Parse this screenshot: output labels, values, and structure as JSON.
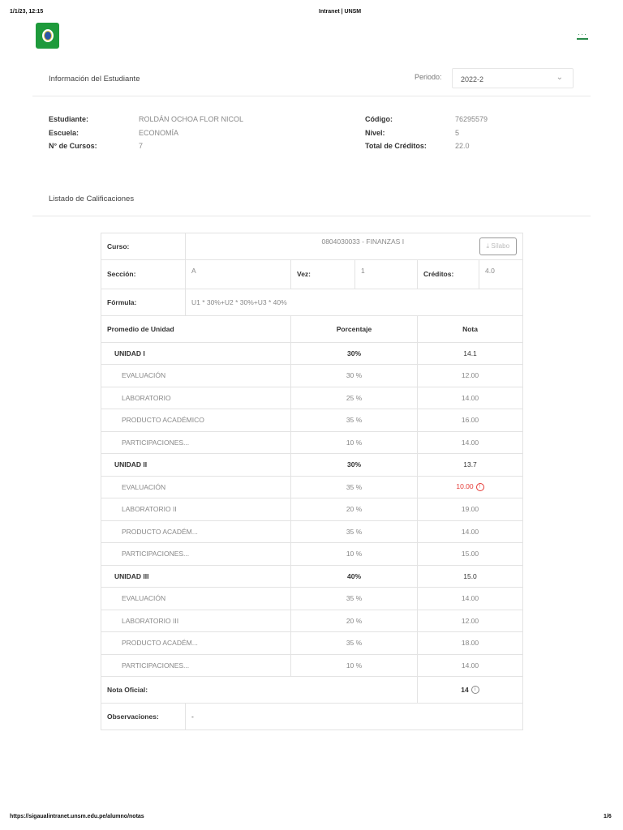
{
  "print_header": {
    "datetime": "1/1/23, 12:15",
    "page_title": "Intranet | UNSM"
  },
  "print_footer": {
    "url": "https://sigaualintranet.unsm.edu.pe/alumno/notas",
    "page": "1/6"
  },
  "student_section": {
    "title": "Información del Estudiante",
    "periodo_label": "Periodo:",
    "periodo_value": "2022-2"
  },
  "student": {
    "estudiante_label": "Estudiante:",
    "estudiante": "ROLDÁN OCHOA FLOR NICOL",
    "escuela_label": "Escuela:",
    "escuela": "ECONOMÍA",
    "cursos_label": "N° de Cursos:",
    "cursos": "7",
    "codigo_label": "Código:",
    "codigo": "76295579",
    "nivel_label": "Nivel:",
    "nivel": "5",
    "creditos_label": "Total de Créditos:",
    "creditos": "22.0"
  },
  "grades_section": {
    "title": "Listado de Calificaciones"
  },
  "course": {
    "curso_label": "Curso:",
    "curso": "0804030033 - FINANZAS I",
    "silabo_label": "Sílabo",
    "seccion_label": "Sección:",
    "seccion": "A",
    "vez_label": "Vez:",
    "vez": "1",
    "creditos_label": "Créditos:",
    "creditos": "4.0",
    "formula_label": "Fórmula:",
    "formula": "U1 * 30%+U2 * 30%+U3 * 40%",
    "headers": [
      "Promedio de Unidad",
      "Porcentaje",
      "Nota"
    ],
    "rows": [
      {
        "unit": true,
        "name": "UNIDAD I",
        "pct": "30%",
        "nota": "14.1"
      },
      {
        "name": "EVALUACIÓN",
        "pct": "30 %",
        "nota": "12.00"
      },
      {
        "name": "LABORATORIO",
        "pct": "25 %",
        "nota": "14.00"
      },
      {
        "name": "PRODUCTO ACADÉMICO",
        "pct": "35 %",
        "nota": "16.00"
      },
      {
        "name": "PARTICIPACIONES...",
        "pct": "10 %",
        "nota": "14.00"
      },
      {
        "unit": true,
        "name": "UNIDAD II",
        "pct": "30%",
        "nota": "13.7"
      },
      {
        "name": "EVALUACIÓN",
        "pct": "35 %",
        "nota": "10.00",
        "alert": true
      },
      {
        "name": "LABORATORIO II",
        "pct": "20 %",
        "nota": "19.00"
      },
      {
        "name": "PRODUCTO ACADÉM...",
        "pct": "35 %",
        "nota": "14.00"
      },
      {
        "name": "PARTICIPACIONES...",
        "pct": "10 %",
        "nota": "15.00"
      },
      {
        "unit": true,
        "name": "UNIDAD III",
        "pct": "40%",
        "nota": "15.0"
      },
      {
        "name": "EVALUACIÓN",
        "pct": "35 %",
        "nota": "14.00"
      },
      {
        "name": "LABORATORIO III",
        "pct": "20 %",
        "nota": "12.00"
      },
      {
        "name": "PRODUCTO ACADÉM...",
        "pct": "35 %",
        "nota": "18.00"
      },
      {
        "name": "PARTICIPACIONES...",
        "pct": "10 %",
        "nota": "14.00"
      }
    ],
    "nota_oficial_label": "Nota Oficial:",
    "nota_oficial": "14",
    "observaciones_label": "Observaciones:",
    "observaciones": "-"
  },
  "colors": {
    "accent": "#1e9a3b",
    "alert": "#e53935"
  }
}
